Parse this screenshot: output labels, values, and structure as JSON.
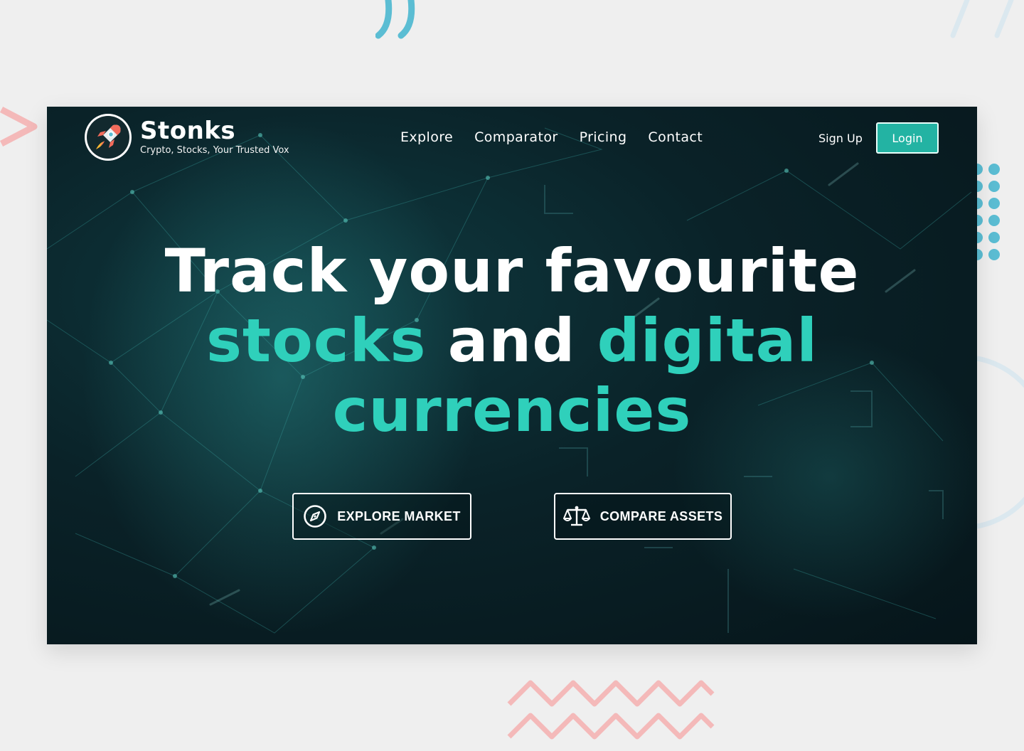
{
  "brand": {
    "name": "Stonks",
    "tagline": "Crypto, Stocks, Your Trusted Vox",
    "logo_icon": "rocket-icon"
  },
  "nav": {
    "links": [
      "Explore",
      "Comparator",
      "Pricing",
      "Contact"
    ],
    "signup_label": "Sign Up",
    "login_label": "Login"
  },
  "hero": {
    "line1": "Track your favourite",
    "line2_a": "stocks",
    "line2_b": "and",
    "line2_c": "digital",
    "line3": "currencies"
  },
  "buttons": {
    "explore_label": "EXPLORE MARKET",
    "explore_icon": "compass-icon",
    "compare_label": "COMPARE ASSETS",
    "compare_icon": "scale-icon"
  },
  "colors": {
    "accent": "#2fd0bb",
    "login_bg": "#23b3a3",
    "page_bg": "#efefef",
    "hero_bg": "#0a2228",
    "deco_pink": "#f4b9b9",
    "deco_blue": "#5bbdd3"
  }
}
